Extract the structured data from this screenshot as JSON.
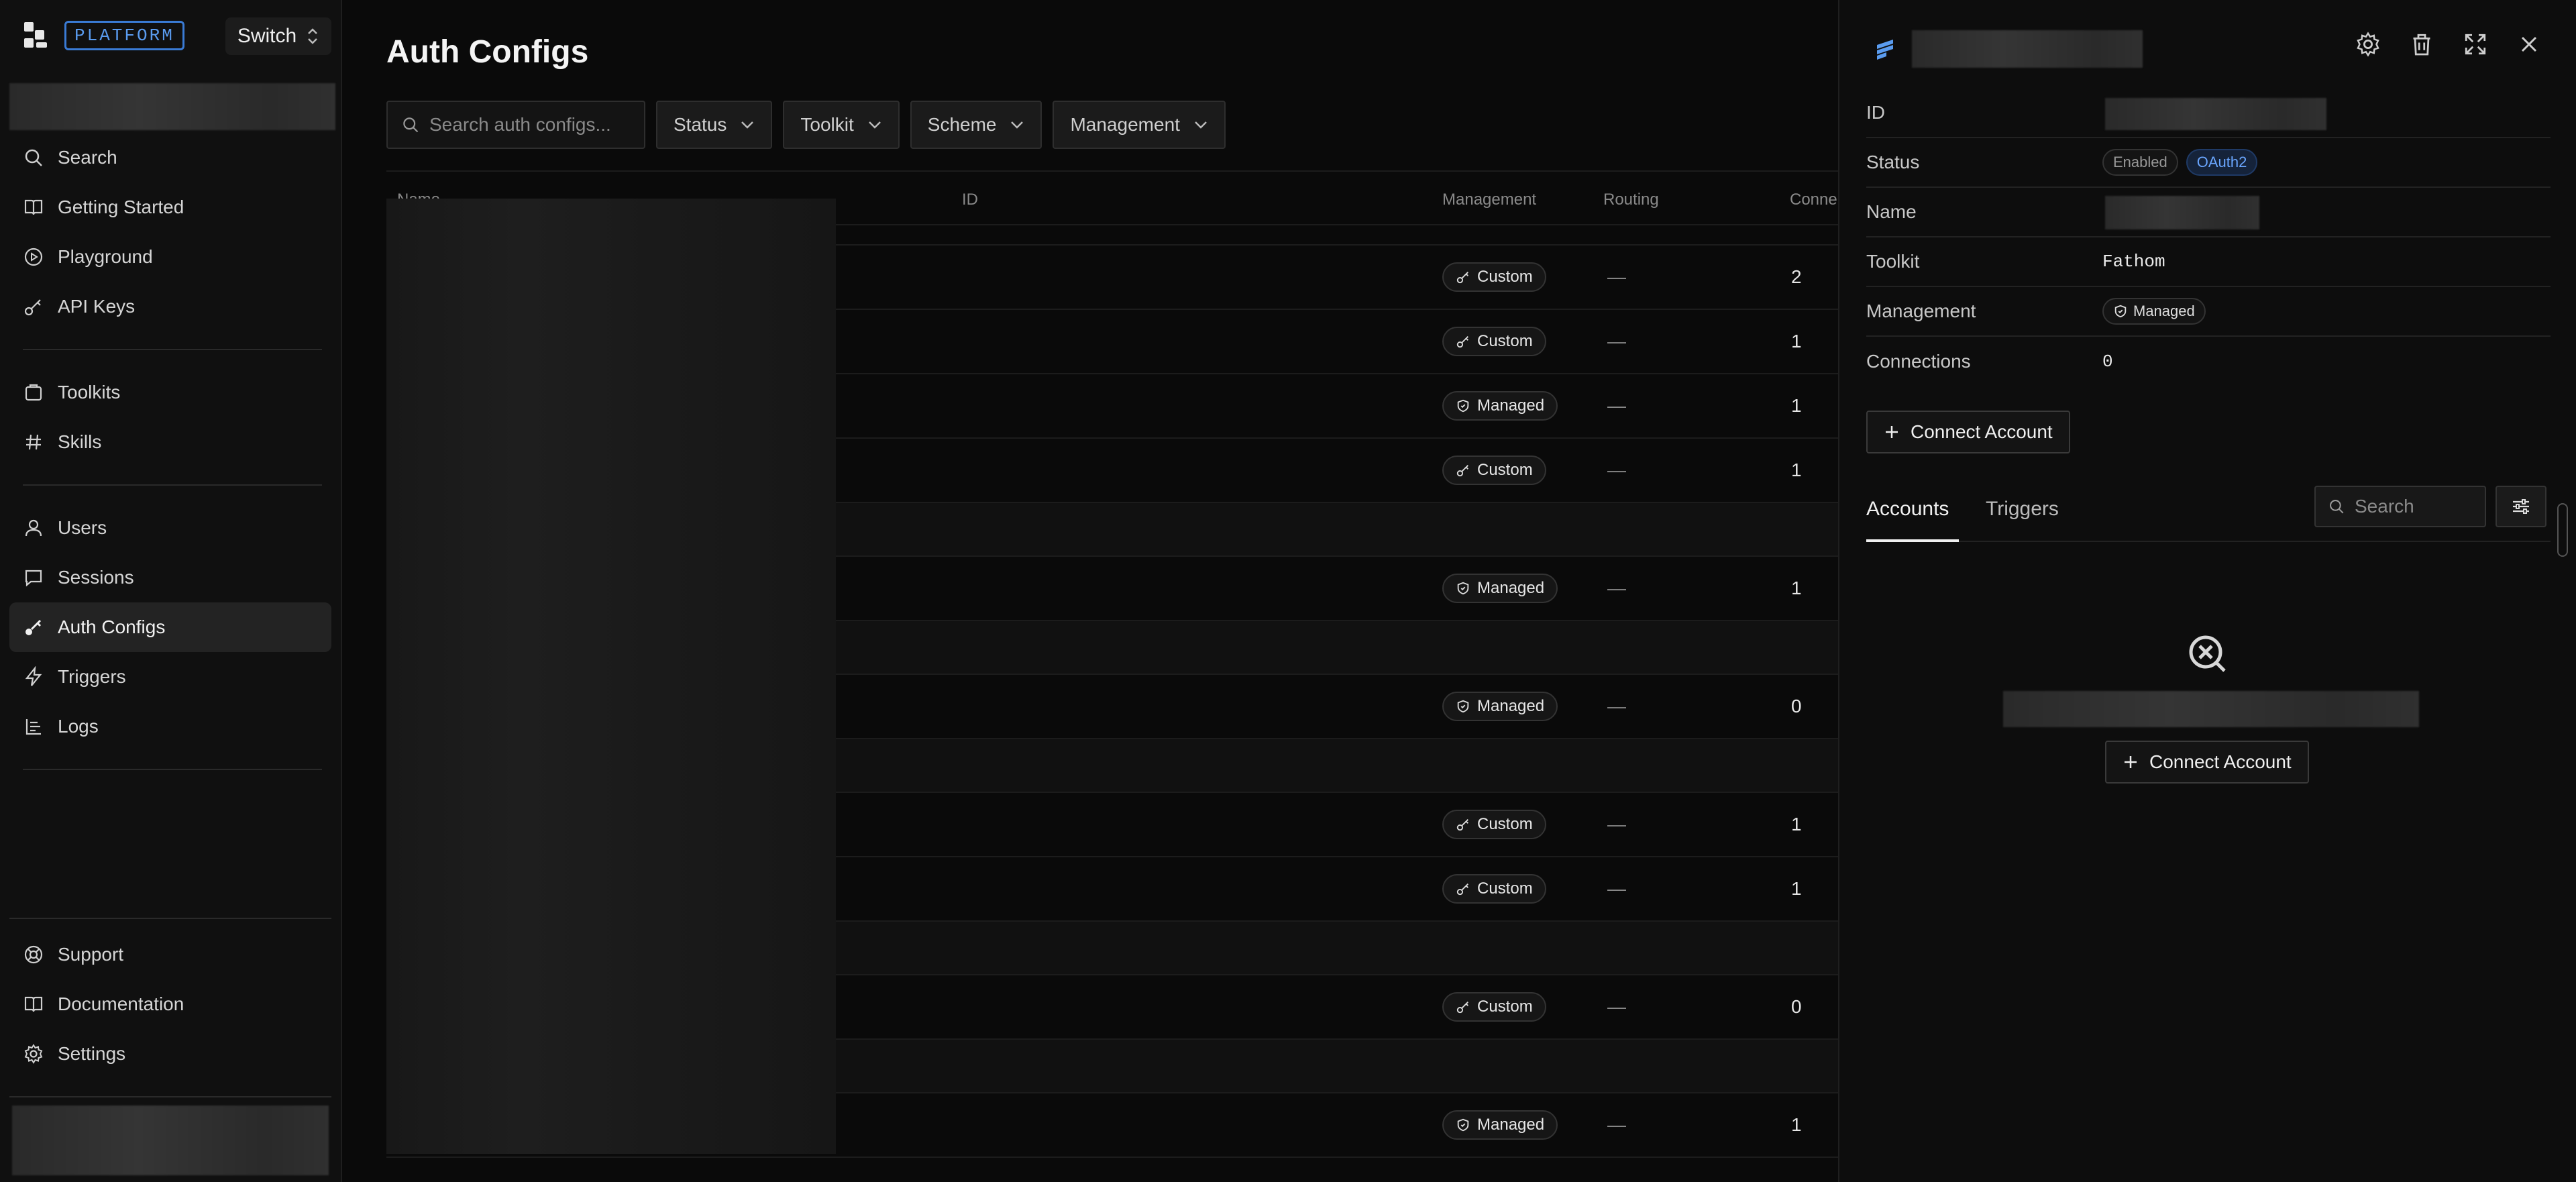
{
  "sidebar": {
    "brand": "PLATFORM",
    "switch_label": "Switch",
    "nav_group_1": [
      {
        "label": "Search",
        "icon": "search-icon"
      },
      {
        "label": "Getting Started",
        "icon": "book-icon"
      },
      {
        "label": "Playground",
        "icon": "play-icon"
      },
      {
        "label": "API Keys",
        "icon": "key-icon"
      }
    ],
    "nav_group_2": [
      {
        "label": "Toolkits",
        "icon": "package-icon"
      },
      {
        "label": "Skills",
        "icon": "hash-icon"
      }
    ],
    "nav_group_3": [
      {
        "label": "Users",
        "icon": "user-icon"
      },
      {
        "label": "Sessions",
        "icon": "chat-icon"
      },
      {
        "label": "Auth Configs",
        "icon": "key-icon",
        "active": true
      },
      {
        "label": "Triggers",
        "icon": "bolt-icon"
      },
      {
        "label": "Logs",
        "icon": "logs-icon"
      }
    ],
    "bottom": [
      {
        "label": "Support",
        "icon": "lifebuoy-icon"
      },
      {
        "label": "Documentation",
        "icon": "book-icon"
      },
      {
        "label": "Settings",
        "icon": "gear-icon"
      }
    ]
  },
  "main": {
    "title": "Auth Configs",
    "search_placeholder": "Search auth configs...",
    "filters": [
      "Status",
      "Toolkit",
      "Scheme",
      "Management"
    ],
    "columns": [
      "Name",
      "ID",
      "Management",
      "Routing",
      "Conne"
    ],
    "rows": [
      {
        "type": "thin"
      },
      {
        "management": "Custom",
        "routing": "—",
        "connections": "2"
      },
      {
        "management": "Custom",
        "routing": "—",
        "connections": "1"
      },
      {
        "management": "Managed",
        "routing": "—",
        "connections": "1"
      },
      {
        "management": "Custom",
        "routing": "—",
        "connections": "1"
      },
      {
        "type": "spacer"
      },
      {
        "management": "Managed",
        "routing": "—",
        "connections": "1"
      },
      {
        "type": "spacer"
      },
      {
        "management": "Managed",
        "routing": "—",
        "connections": "0"
      },
      {
        "type": "spacer"
      },
      {
        "management": "Custom",
        "routing": "—",
        "connections": "1"
      },
      {
        "management": "Custom",
        "routing": "—",
        "connections": "1"
      },
      {
        "type": "spacer"
      },
      {
        "management": "Custom",
        "routing": "—",
        "connections": "0"
      },
      {
        "type": "spacer"
      },
      {
        "management": "Managed",
        "routing": "—",
        "connections": "1"
      }
    ]
  },
  "panel": {
    "props": {
      "id_label": "ID",
      "status_label": "Status",
      "status_enabled": "Enabled",
      "status_scheme": "OAuth2",
      "name_label": "Name",
      "toolkit_label": "Toolkit",
      "toolkit_value": "Fathom",
      "management_label": "Management",
      "management_value": "Managed",
      "connections_label": "Connections",
      "connections_value": "0"
    },
    "connect_account_label": "Connect Account",
    "tabs": [
      "Accounts",
      "Triggers"
    ],
    "search_placeholder": "Search",
    "empty_connect_label": "Connect Account"
  },
  "colors": {
    "accent": "#3a7bd5",
    "background": "#0a0a0a",
    "oauth_pill": "#6aa6ff"
  }
}
